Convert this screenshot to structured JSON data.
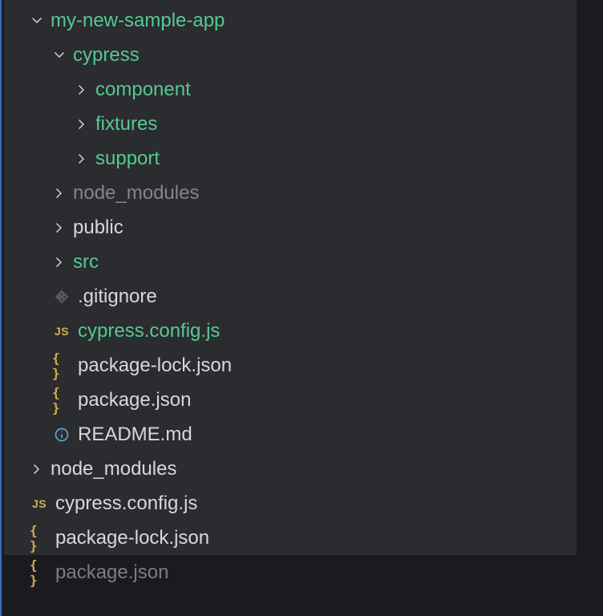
{
  "tree": {
    "root": {
      "label": "my-new-sample-app",
      "color": "green",
      "expanded": true
    },
    "items": [
      {
        "id": "cypress",
        "label": "cypress",
        "type": "folder",
        "color": "green",
        "expanded": true,
        "depth": 1
      },
      {
        "id": "component",
        "label": "component",
        "type": "folder",
        "color": "green",
        "expanded": false,
        "depth": 2
      },
      {
        "id": "fixtures",
        "label": "fixtures",
        "type": "folder",
        "color": "green",
        "expanded": false,
        "depth": 2
      },
      {
        "id": "support",
        "label": "support",
        "type": "folder",
        "color": "green",
        "expanded": false,
        "depth": 2
      },
      {
        "id": "node_modules1",
        "label": "node_modules",
        "type": "folder",
        "color": "grey",
        "expanded": false,
        "depth": 1
      },
      {
        "id": "public",
        "label": "public",
        "type": "folder",
        "color": "white",
        "expanded": false,
        "depth": 1
      },
      {
        "id": "src",
        "label": "src",
        "type": "folder",
        "color": "green",
        "expanded": false,
        "depth": 1
      },
      {
        "id": "gitignore",
        "label": ".gitignore",
        "type": "file",
        "icon": "git",
        "color": "white",
        "depth": 1
      },
      {
        "id": "cyconf1",
        "label": "cypress.config.js",
        "type": "file",
        "icon": "js",
        "color": "green",
        "depth": 1
      },
      {
        "id": "pkglock1",
        "label": "package-lock.json",
        "type": "file",
        "icon": "json",
        "color": "white",
        "depth": 1
      },
      {
        "id": "pkg1",
        "label": "package.json",
        "type": "file",
        "icon": "json",
        "color": "white",
        "depth": 1
      },
      {
        "id": "readme",
        "label": "README.md",
        "type": "file",
        "icon": "info",
        "color": "white",
        "depth": 1
      }
    ],
    "outside": [
      {
        "id": "node_modules2",
        "label": "node_modules",
        "type": "folder",
        "color": "white",
        "expanded": false,
        "depth": 0
      },
      {
        "id": "cyconf2",
        "label": "cypress.config.js",
        "type": "file",
        "icon": "js",
        "color": "white",
        "depth": 0
      },
      {
        "id": "pkglock2",
        "label": "package-lock.json",
        "type": "file",
        "icon": "json",
        "color": "white",
        "depth": 0
      },
      {
        "id": "pkg2",
        "label": "package.json",
        "type": "file",
        "icon": "json",
        "color": "dim",
        "depth": 0
      }
    ]
  },
  "icons": {
    "js": "JS",
    "json": "{ }"
  }
}
